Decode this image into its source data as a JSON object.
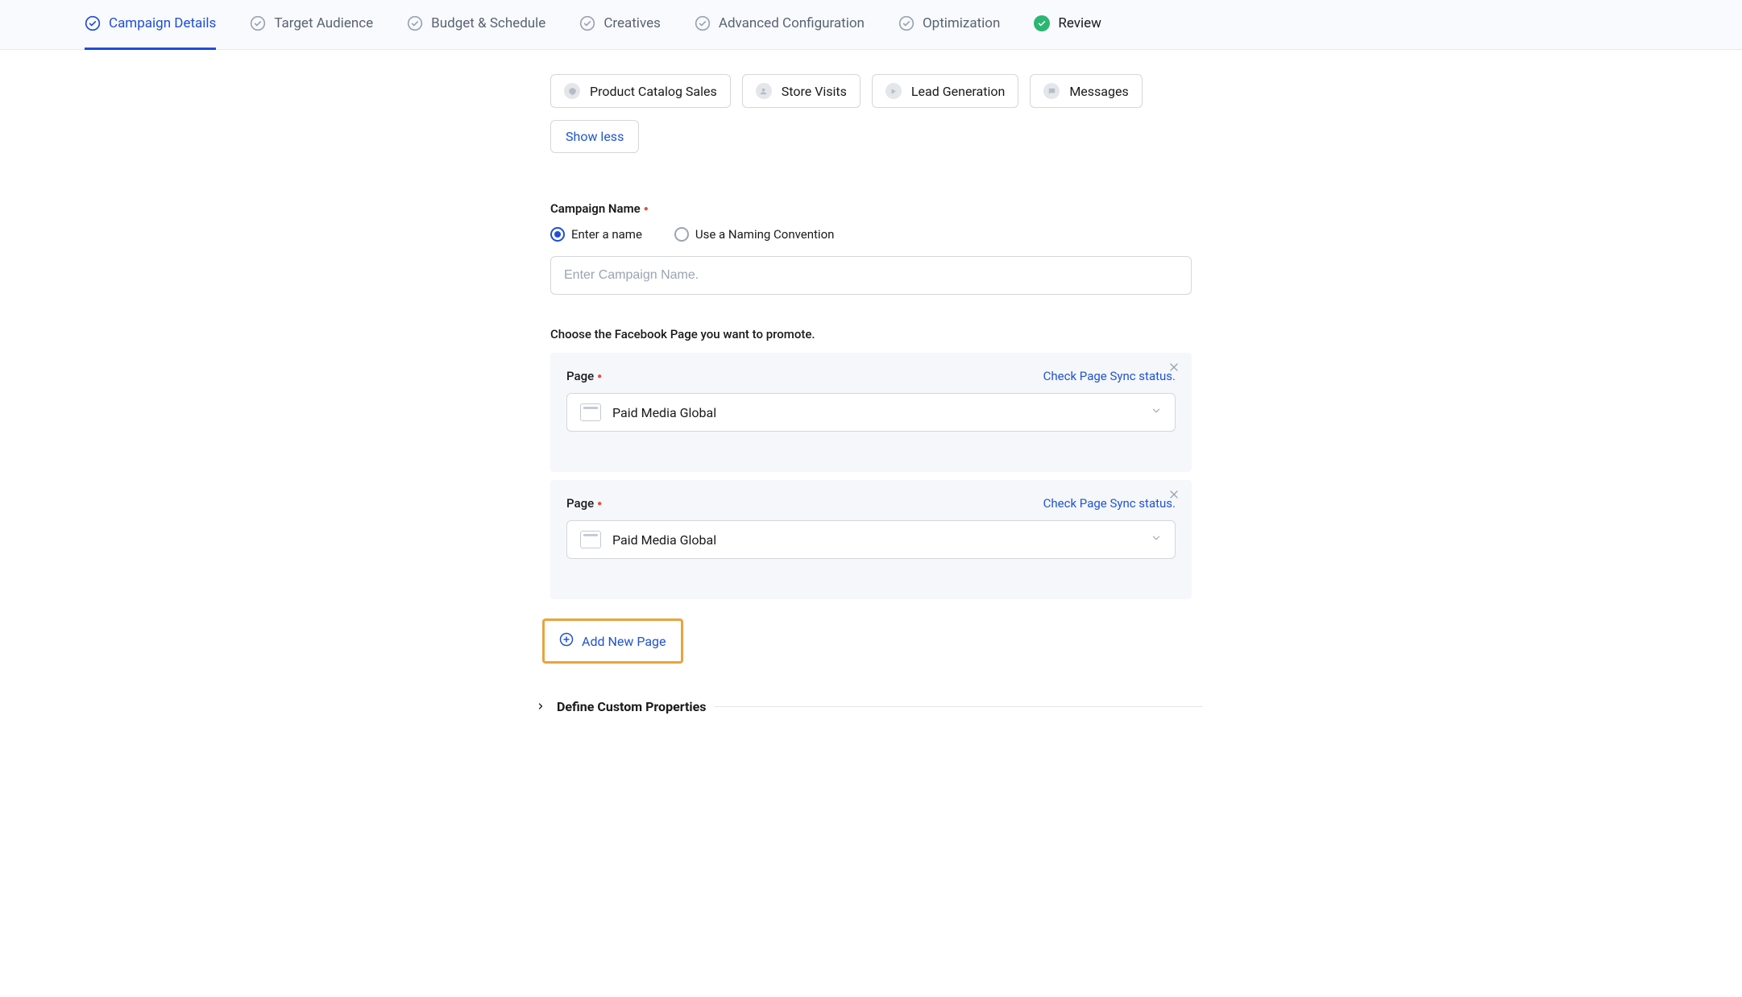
{
  "tabs": [
    {
      "label": "Campaign Details",
      "state": "active"
    },
    {
      "label": "Target Audience",
      "state": "pending"
    },
    {
      "label": "Budget & Schedule",
      "state": "pending"
    },
    {
      "label": "Creatives",
      "state": "pending"
    },
    {
      "label": "Advanced Configuration",
      "state": "pending"
    },
    {
      "label": "Optimization",
      "state": "pending"
    },
    {
      "label": "Review",
      "state": "done"
    }
  ],
  "objectives": [
    {
      "label": "Product Catalog Sales"
    },
    {
      "label": "Store Visits"
    },
    {
      "label": "Lead Generation"
    },
    {
      "label": "Messages"
    }
  ],
  "show_less": "Show less",
  "campaign_name": {
    "label": "Campaign Name",
    "radio_enter": "Enter a name",
    "radio_convention": "Use a Naming Convention",
    "placeholder": "Enter Campaign Name.",
    "value": ""
  },
  "page_section": {
    "heading": "Choose the Facebook Page you want to promote.",
    "cards": [
      {
        "label": "Page",
        "sync_link": "Check Page Sync status.",
        "value": "Paid Media Global"
      },
      {
        "label": "Page",
        "sync_link": "Check Page Sync status.",
        "value": "Paid Media Global"
      }
    ]
  },
  "add_new_page": "Add New Page",
  "custom_properties": "Define Custom Properties"
}
